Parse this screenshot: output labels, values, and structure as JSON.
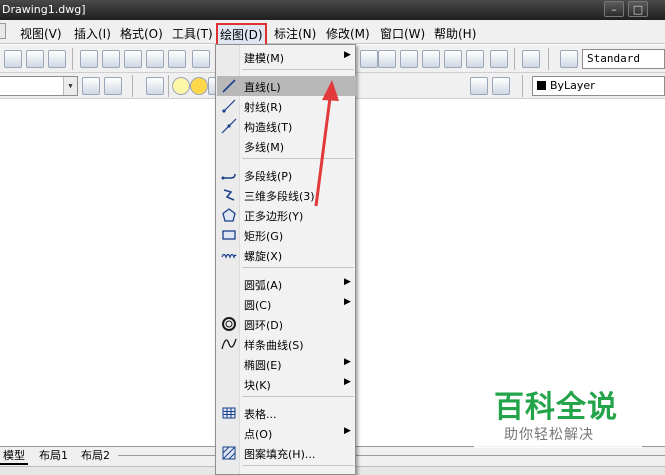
{
  "window": {
    "title": "Drawing1.dwg]",
    "min": "–",
    "max": "□"
  },
  "menubar": {
    "items": [
      "视图(V)",
      "插入(I)",
      "格式(O)",
      "工具(T)",
      "绘图(D)",
      "标注(N)",
      "修改(M)",
      "窗口(W)",
      "帮助(H)"
    ]
  },
  "toolbar": {
    "style_combo": "Standard",
    "layer_combo": "ByLayer"
  },
  "draw_menu": {
    "items": [
      {
        "label": "建模(M)",
        "submenu": true,
        "icon": ""
      },
      {
        "label": "直线(L)",
        "submenu": false,
        "icon": "line-icon",
        "highlighted": true
      },
      {
        "label": "射线(R)",
        "submenu": false,
        "icon": "ray-icon"
      },
      {
        "label": "构造线(T)",
        "submenu": false,
        "icon": "xline-icon"
      },
      {
        "label": "多线(M)",
        "submenu": false,
        "icon": ""
      },
      {
        "label": "多段线(P)",
        "submenu": false,
        "icon": "polyline-icon"
      },
      {
        "label": "三维多段线(3)",
        "submenu": false,
        "icon": "3d-polyline-icon"
      },
      {
        "label": "正多边形(Y)",
        "submenu": false,
        "icon": "polygon-icon"
      },
      {
        "label": "矩形(G)",
        "submenu": false,
        "icon": "rectangle-icon"
      },
      {
        "label": "螺旋(X)",
        "submenu": false,
        "icon": "helix-icon"
      },
      {
        "label": "圆弧(A)",
        "submenu": true,
        "icon": ""
      },
      {
        "label": "圆(C)",
        "submenu": true,
        "icon": ""
      },
      {
        "label": "圆环(D)",
        "submenu": false,
        "icon": "donut-icon"
      },
      {
        "label": "样条曲线(S)",
        "submenu": false,
        "icon": "spline-icon"
      },
      {
        "label": "椭圆(E)",
        "submenu": true,
        "icon": ""
      },
      {
        "label": "块(K)",
        "submenu": true,
        "icon": ""
      },
      {
        "label": "表格...",
        "submenu": false,
        "icon": "table-icon"
      },
      {
        "label": "点(O)",
        "submenu": true,
        "icon": ""
      },
      {
        "label": "图案填充(H)...",
        "submenu": false,
        "icon": "hatch-icon"
      }
    ],
    "submenu_arrow": "▶"
  },
  "layout_tabs": [
    "模型",
    "布局1",
    "布局2"
  ],
  "watermark": {
    "title": "百科全说",
    "subtitle": "助你轻松解决"
  },
  "colors": {
    "highlight_box": "#e03030",
    "menu_highlight": "#b8b8b8",
    "watermark_green": "#24a44a"
  }
}
